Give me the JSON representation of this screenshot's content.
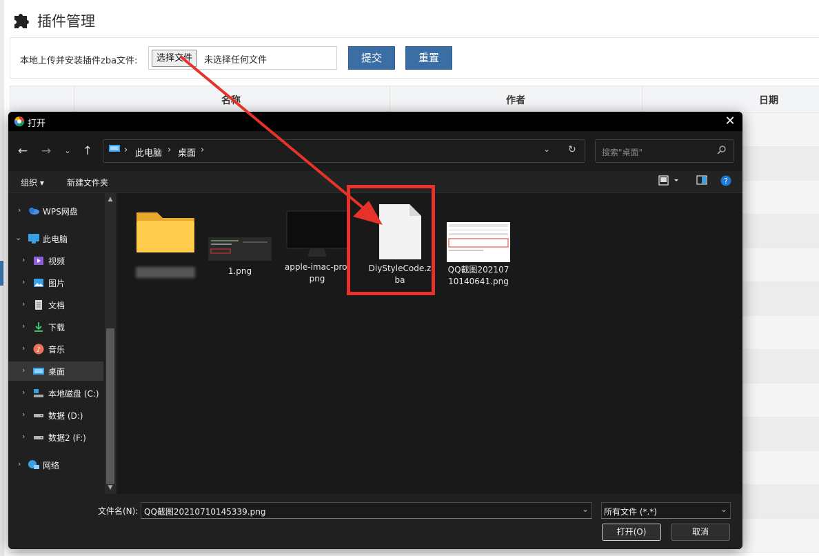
{
  "page": {
    "title": "插件管理",
    "upload_label": "本地上传并安装插件zba文件:",
    "choose_file_label": "选择文件",
    "no_file_text": "未选择任何文件",
    "submit_label": "提交",
    "reset_label": "重置",
    "table_headers": [
      "名称",
      "作者",
      "日期"
    ]
  },
  "dialog": {
    "title": "打开",
    "breadcrumb": [
      "此电脑",
      "桌面"
    ],
    "search_placeholder": "搜索\"桌面\"",
    "toolbar": {
      "organize": "组织",
      "new_folder": "新建文件夹"
    },
    "sidebar": [
      {
        "label": "WPS网盘",
        "icon": "cloud-icon"
      },
      {
        "label": "此电脑",
        "icon": "computer-icon"
      },
      {
        "label": "视频",
        "icon": "video-icon"
      },
      {
        "label": "图片",
        "icon": "picture-icon"
      },
      {
        "label": "文档",
        "icon": "document-icon"
      },
      {
        "label": "下载",
        "icon": "download-icon"
      },
      {
        "label": "音乐",
        "icon": "music-icon"
      },
      {
        "label": "桌面",
        "icon": "desktop-icon"
      },
      {
        "label": "本地磁盘 (C:)",
        "icon": "drive-icon"
      },
      {
        "label": "数据 (D:)",
        "icon": "drive-icon"
      },
      {
        "label": "数据2 (F:)",
        "icon": "drive-icon"
      },
      {
        "label": "网络",
        "icon": "network-icon"
      }
    ],
    "files": [
      {
        "name": "",
        "icon": "folder-icon"
      },
      {
        "name": "1.png",
        "icon": "image-thumbnail"
      },
      {
        "name": "apple-imac-pro.png",
        "icon": "imac-thumbnail"
      },
      {
        "name": "DiyStyleCode.zba",
        "icon": "blank-file-icon"
      },
      {
        "name": "QQ截图20210710140641.png",
        "icon": "screenshot-thumbnail"
      }
    ],
    "filename_label": "文件名(N):",
    "filename_value": "QQ截图20210710145339.png",
    "filetype_value": "所有文件 (*.*)",
    "open_label": "打开(O)",
    "cancel_label": "取消"
  },
  "colors": {
    "accent": "#3b6ea5",
    "highlight": "#e5322b",
    "dialog_bg": "#202020"
  }
}
